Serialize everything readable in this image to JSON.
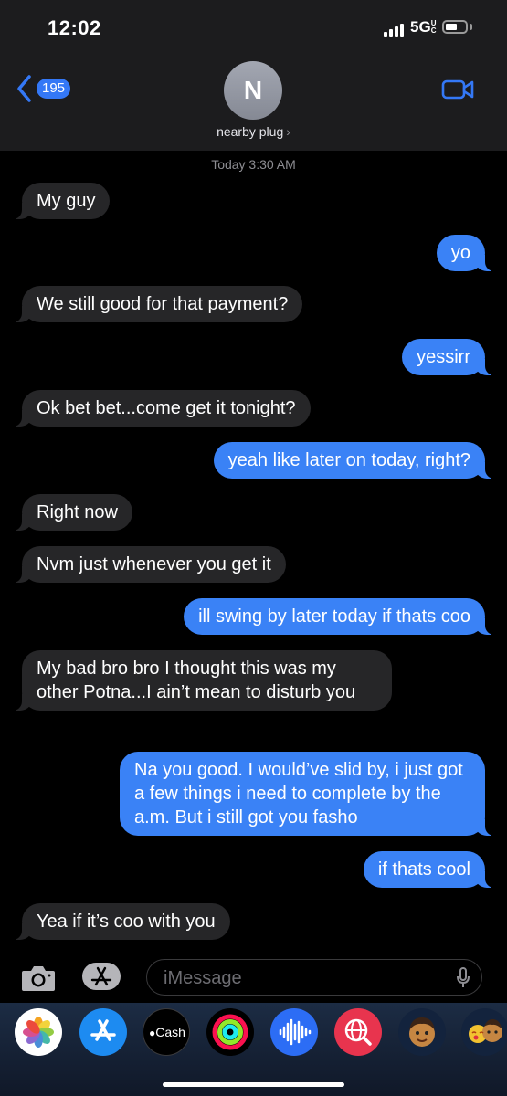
{
  "status_bar": {
    "time": "12:02",
    "network": "5G",
    "network_sub": "UC"
  },
  "header": {
    "back_badge": "195",
    "avatar_initial": "N",
    "contact_name": "nearby plug",
    "contact_chevron": "›"
  },
  "thread": {
    "timestamp": "Today 3:30 AM",
    "messages": [
      {
        "from": "them",
        "text": "My guy"
      },
      {
        "from": "me",
        "text": "yo"
      },
      {
        "from": "them",
        "text": "We still good for that payment?"
      },
      {
        "from": "me",
        "text": "yessirr"
      },
      {
        "from": "them",
        "text": "Ok bet bet...come get it tonight?"
      },
      {
        "from": "me",
        "text": "yeah like later on today, right?"
      },
      {
        "from": "them",
        "text": "Right now"
      },
      {
        "from": "them",
        "text": "Nvm just whenever you get it"
      },
      {
        "from": "me",
        "text": "ill swing by later today if thats coo"
      },
      {
        "from": "them",
        "text": "My bad bro bro I thought this was my other Potna...I ain’t mean to disturb you"
      },
      {
        "from": "me",
        "text": "Na you good. I would’ve slid by, i just got a few things i need to complete by the a.m. But i still got you fasho"
      },
      {
        "from": "me",
        "text": "if thats cool"
      },
      {
        "from": "them",
        "text": "Yea if it’s coo with you"
      }
    ]
  },
  "composer": {
    "placeholder": "iMessage"
  },
  "app_drawer": {
    "apps": [
      {
        "name": "photos-icon"
      },
      {
        "name": "app-store-icon"
      },
      {
        "name": "apple-cash-icon",
        "label": "Cash"
      },
      {
        "name": "fitness-icon"
      },
      {
        "name": "audio-message-icon"
      },
      {
        "name": "web-images-icon"
      },
      {
        "name": "memoji-icon"
      },
      {
        "name": "memoji-stickers-icon"
      }
    ]
  },
  "colors": {
    "outgoing": "#3a82f6",
    "incoming": "#262628",
    "accent": "#3478f6",
    "background": "#000000"
  }
}
